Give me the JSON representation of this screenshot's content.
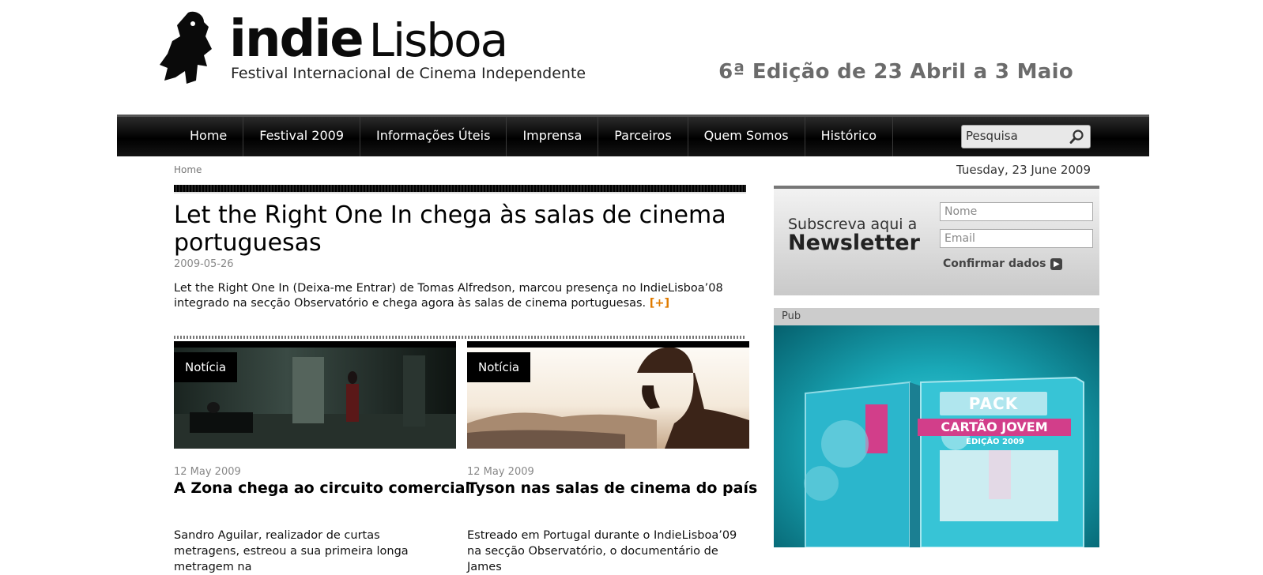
{
  "header": {
    "logo_word_indie": "indie",
    "logo_word_lisboa": "Lisboa",
    "logo_subtitle": "Festival Internacional de Cinema Independente",
    "edition": "6ª Edição de 23 Abril a 3 Maio"
  },
  "nav": {
    "items": [
      "Home",
      "Festival 2009",
      "Informações Úteis",
      "Imprensa",
      "Parceiros",
      "Quem Somos",
      "Histórico"
    ],
    "search_placeholder": "Pesquisa"
  },
  "breadcrumb": "Home",
  "date": "Tuesday, 23 June 2009",
  "feature": {
    "title": "Let the Right One In chega às salas de cinema portuguesas",
    "date": "2009-05-26",
    "lead": "Let the Right One In (Deixa-me Entrar) de Tomas Alfredson, marcou presença no IndieLisboa’08 integrado na secção Observatório e chega agora às salas de cinema portuguesas.",
    "more": "[+]"
  },
  "cards": [
    {
      "tag": "Notícia",
      "date": "12 May 2009",
      "title": "A Zona chega ao circuito comercial",
      "excerpt": "Sandro Aguilar, realizador de curtas metragens, estreou a sua primeira longa metragem na"
    },
    {
      "tag": "Notícia",
      "date": "12 May 2009",
      "title": "Tyson nas salas de cinema do país",
      "excerpt": "Estreado em Portugal durante o IndieLisboa’09 na secção Observatório, o documentário de James"
    }
  ],
  "newsletter": {
    "line1": "Subscreva aqui a",
    "line2": "Newsletter",
    "name_placeholder": "Nome",
    "email_placeholder": "Email",
    "confirm": "Confirmar dados"
  },
  "ad": {
    "label": "Pub",
    "pack": "PACK",
    "product": "CARTÃO JOVEM",
    "edition": "EDIÇÃO 2009"
  }
}
